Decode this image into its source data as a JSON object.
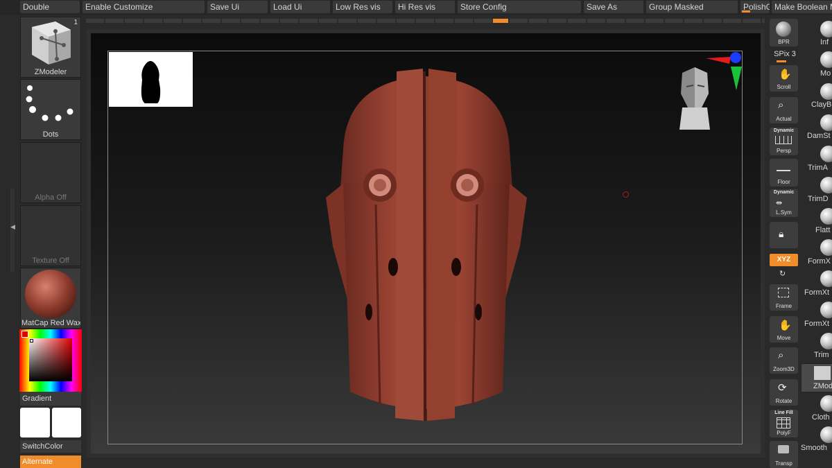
{
  "top_menu": {
    "items": [
      "Double",
      "Enable Customize",
      "Save Ui",
      "Load Ui",
      "Low Res vis",
      "Hi Res vis",
      "Store Config",
      "Save As",
      "Group Masked",
      "PolishG",
      "Make Boolean M"
    ]
  },
  "left_shelf": {
    "tool_label": "ZModeler",
    "tool_badge": "1",
    "stroke_label": "Dots",
    "alpha_label": "Alpha Off",
    "texture_label": "Texture Off",
    "material_label": "MatCap Red Wax",
    "gradient_label": "Gradient",
    "switchcolor_label": "SwitchColor",
    "alternate_label": "Alternate"
  },
  "right_shelf": {
    "bpr_label": "BPR",
    "spix_label": "SPix 3",
    "scroll_label": "Scroll",
    "actual_label": "Actual",
    "persp_top": "Dynamic",
    "persp_label": "Persp",
    "floor_label": "Floor",
    "lsym_top": "Dynamic",
    "lsym_label": "L.Sym",
    "xyz_label": "XYZ",
    "frame_label": "Frame",
    "move_label": "Move",
    "zoom_label": "Zoom3D",
    "rotate_label": "Rotate",
    "polyf_top": "Line Fill",
    "polyf_label": "PolyF",
    "transp_label": "Transp"
  },
  "brushes": [
    "Inf",
    "Mo",
    "ClayB",
    "DamSt",
    "TrimA",
    "TrimD",
    "Flatt",
    "FormX",
    "FormXt",
    "FormXt",
    "Trim",
    "ZMod",
    "Cloth",
    "Smooth"
  ],
  "colors": {
    "accent": "#f08c2a",
    "model": "#8c3a2c",
    "panel": "#3a3a3a"
  }
}
